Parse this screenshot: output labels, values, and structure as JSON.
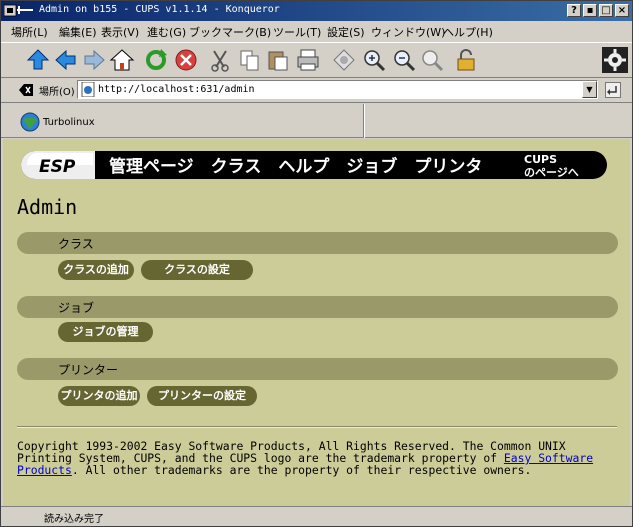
{
  "window": {
    "title": "Admin on b155 - CUPS v1.1.14 - Konqueror",
    "buttons": [
      "?",
      "▪",
      "□",
      "×"
    ]
  },
  "menu": [
    "場所(L)",
    "編集(E)",
    "表示(V)",
    "進む(G)",
    "ブックマーク(B)",
    "ツール(T)",
    "設定(S)",
    "ウィンドウ(W)",
    "ヘルプ(H)"
  ],
  "toolbar": {
    "icons": [
      "up-arrow-icon",
      "back-arrow-icon",
      "forward-arrow-icon",
      "home-icon",
      "reload-icon",
      "stop-icon",
      "cut-icon",
      "copy-icon",
      "paste-icon",
      "print-icon",
      "security-icon",
      "zoom-in-icon",
      "zoom-out-icon",
      "find-icon",
      "lock-icon",
      "konqueror-gear-icon"
    ]
  },
  "location": {
    "label": "場所(O)",
    "url": "http://localhost:631/admin"
  },
  "bookmarks": {
    "item": "Turbolinux"
  },
  "page": {
    "banner_logo": "ESP",
    "banner_nav": "管理ページ　クラス　ヘルプ　ジョブ　プリンタ",
    "banner_cups_line1": "CUPS",
    "banner_cups_line2": "のページへ",
    "title": "Admin",
    "sections": [
      {
        "label": "クラス",
        "buttons": [
          "クラスの追加",
          "クラスの設定"
        ]
      },
      {
        "label": "ジョブ",
        "buttons": [
          "ジョブの管理"
        ]
      },
      {
        "label": "プリンター",
        "buttons": [
          "プリンタの追加",
          "プリンターの設定"
        ]
      }
    ],
    "copyright_line1": "Copyright 1993-2002 Easy Software Products, All Rights Reserved. The Common UNIX",
    "copyright_line2": "Printing System, CUPS, and the CUPS logo are the trademark property of",
    "copyright_link": "Easy Software Products",
    "copyright_line3": ". All other trademarks are the property of their respective owners."
  },
  "status": {
    "text": "読み込み完了"
  },
  "colors": {
    "page_bg": "#cccc99",
    "section_bar": "#99996a",
    "button_bg": "#666633",
    "link": "#0000cc",
    "titlebar": "#0a246a"
  }
}
